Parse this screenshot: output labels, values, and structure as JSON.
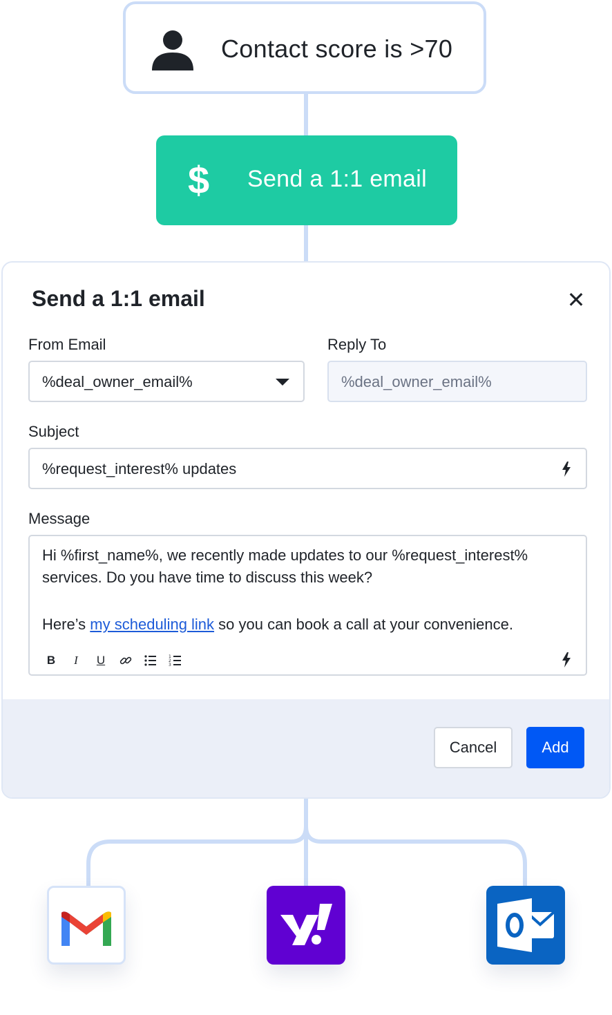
{
  "trigger": {
    "label": "Contact score is >70",
    "icon": "person-icon"
  },
  "action": {
    "label": "Send a 1:1 email",
    "icon": "dollar-icon"
  },
  "panel": {
    "title": "Send a 1:1 email",
    "from_email": {
      "label": "From Email",
      "value": "%deal_owner_email%"
    },
    "reply_to": {
      "label": "Reply To",
      "placeholder": "%deal_owner_email%"
    },
    "subject": {
      "label": "Subject",
      "value": "%request_interest% updates"
    },
    "message": {
      "label": "Message",
      "line1": "Hi %first_name%, we recently made updates to our %request_interest%",
      "line2": "services. Do you have time to discuss this week?",
      "line3_prefix": "Here’s ",
      "line3_link": "my scheduling link",
      "line3_suffix": " so you can book a call at your convenience.",
      "toolbar": [
        "bold-icon",
        "italic-icon",
        "underline-icon",
        "link-icon",
        "bulleted-list-icon",
        "numbered-list-icon"
      ]
    },
    "buttons": {
      "cancel": "Cancel",
      "add": "Add"
    }
  },
  "providers": [
    "gmail-icon",
    "yahoo-icon",
    "outlook-icon"
  ],
  "colors": {
    "accent_green": "#1ecba3",
    "primary_blue": "#0058f5",
    "connector": "#cbdcf7",
    "yahoo": "#6001d2",
    "outlook": "#0a64c2"
  }
}
